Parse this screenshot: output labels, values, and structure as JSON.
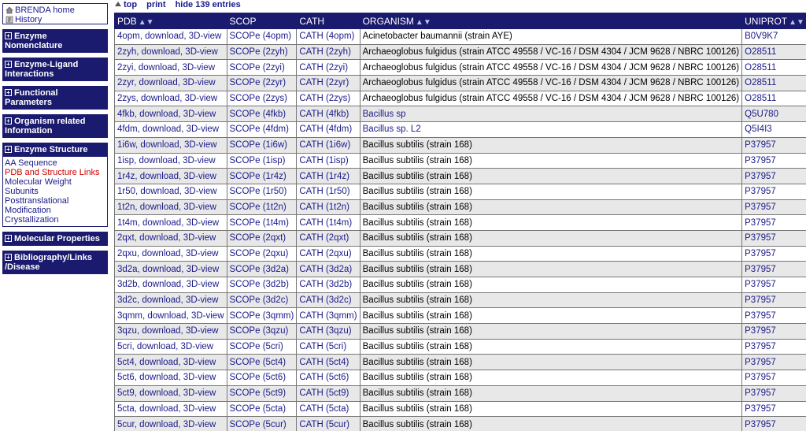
{
  "sidebar": {
    "home": "BRENDA home",
    "history": "History",
    "sections": [
      {
        "label": "Enzyme Nomenclature"
      },
      {
        "label": "Enzyme-Ligand Interactions"
      },
      {
        "label": "Functional Parameters"
      },
      {
        "label": "Organism related Information"
      },
      {
        "label": "Enzyme Structure",
        "items": [
          "AA Sequence",
          "PDB and Structure Links",
          "Molecular Weight",
          "Subunits",
          "Posttranslational Modification",
          "Crystallization"
        ],
        "active": 1
      },
      {
        "label": "Molecular Properties"
      },
      {
        "label": "Bibliography/Links /Disease"
      }
    ]
  },
  "toplinks": {
    "top": "top",
    "print": "print",
    "hide": "hide 139 entries"
  },
  "table": {
    "headers": [
      "PDB",
      "SCOP",
      "CATH",
      "ORGANISM",
      "UNIPROT"
    ],
    "sortable": [
      true,
      false,
      false,
      true,
      true
    ],
    "rows": [
      [
        "4opm, download, 3D-view",
        "SCOPe (4opm)",
        "CATH (4opm)",
        "Acinetobacter baumannii (strain AYE)",
        "B0V9K7"
      ],
      [
        "2zyh, download, 3D-view",
        "SCOPe (2zyh)",
        "CATH (2zyh)",
        "Archaeoglobus fulgidus (strain ATCC 49558 / VC-16 / DSM 4304 / JCM 9628 / NBRC 100126)",
        "O28511"
      ],
      [
        "2zyi, download, 3D-view",
        "SCOPe (2zyi)",
        "CATH (2zyi)",
        "Archaeoglobus fulgidus (strain ATCC 49558 / VC-16 / DSM 4304 / JCM 9628 / NBRC 100126)",
        "O28511"
      ],
      [
        "2zyr, download, 3D-view",
        "SCOPe (2zyr)",
        "CATH (2zyr)",
        "Archaeoglobus fulgidus (strain ATCC 49558 / VC-16 / DSM 4304 / JCM 9628 / NBRC 100126)",
        "O28511"
      ],
      [
        "2zys, download, 3D-view",
        "SCOPe (2zys)",
        "CATH (2zys)",
        "Archaeoglobus fulgidus (strain ATCC 49558 / VC-16 / DSM 4304 / JCM 9628 / NBRC 100126)",
        "O28511"
      ],
      [
        "4fkb, download, 3D-view",
        "SCOPe (4fkb)",
        "CATH (4fkb)",
        "Bacillus sp",
        "Q5U780"
      ],
      [
        "4fdm, download, 3D-view",
        "SCOPe (4fdm)",
        "CATH (4fdm)",
        "Bacillus sp. L2",
        "Q5I4I3"
      ],
      [
        "1i6w, download, 3D-view",
        "SCOPe (1i6w)",
        "CATH (1i6w)",
        "Bacillus subtilis (strain 168)",
        "P37957"
      ],
      [
        "1isp, download, 3D-view",
        "SCOPe (1isp)",
        "CATH (1isp)",
        "Bacillus subtilis (strain 168)",
        "P37957"
      ],
      [
        "1r4z, download, 3D-view",
        "SCOPe (1r4z)",
        "CATH (1r4z)",
        "Bacillus subtilis (strain 168)",
        "P37957"
      ],
      [
        "1r50, download, 3D-view",
        "SCOPe (1r50)",
        "CATH (1r50)",
        "Bacillus subtilis (strain 168)",
        "P37957"
      ],
      [
        "1t2n, download, 3D-view",
        "SCOPe (1t2n)",
        "CATH (1t2n)",
        "Bacillus subtilis (strain 168)",
        "P37957"
      ],
      [
        "1t4m, download, 3D-view",
        "SCOPe (1t4m)",
        "CATH (1t4m)",
        "Bacillus subtilis (strain 168)",
        "P37957"
      ],
      [
        "2qxt, download, 3D-view",
        "SCOPe (2qxt)",
        "CATH (2qxt)",
        "Bacillus subtilis (strain 168)",
        "P37957"
      ],
      [
        "2qxu, download, 3D-view",
        "SCOPe (2qxu)",
        "CATH (2qxu)",
        "Bacillus subtilis (strain 168)",
        "P37957"
      ],
      [
        "3d2a, download, 3D-view",
        "SCOPe (3d2a)",
        "CATH (3d2a)",
        "Bacillus subtilis (strain 168)",
        "P37957"
      ],
      [
        "3d2b, download, 3D-view",
        "SCOPe (3d2b)",
        "CATH (3d2b)",
        "Bacillus subtilis (strain 168)",
        "P37957"
      ],
      [
        "3d2c, download, 3D-view",
        "SCOPe (3d2c)",
        "CATH (3d2c)",
        "Bacillus subtilis (strain 168)",
        "P37957"
      ],
      [
        "3qmm, download, 3D-view",
        "SCOPe (3qmm)",
        "CATH (3qmm)",
        "Bacillus subtilis (strain 168)",
        "P37957"
      ],
      [
        "3qzu, download, 3D-view",
        "SCOPe (3qzu)",
        "CATH (3qzu)",
        "Bacillus subtilis (strain 168)",
        "P37957"
      ],
      [
        "5cri, download, 3D-view",
        "SCOPe (5cri)",
        "CATH (5cri)",
        "Bacillus subtilis (strain 168)",
        "P37957"
      ],
      [
        "5ct4, download, 3D-view",
        "SCOPe (5ct4)",
        "CATH (5ct4)",
        "Bacillus subtilis (strain 168)",
        "P37957"
      ],
      [
        "5ct6, download, 3D-view",
        "SCOPe (5ct6)",
        "CATH (5ct6)",
        "Bacillus subtilis (strain 168)",
        "P37957"
      ],
      [
        "5ct9, download, 3D-view",
        "SCOPe (5ct9)",
        "CATH (5ct9)",
        "Bacillus subtilis (strain 168)",
        "P37957"
      ],
      [
        "5cta, download, 3D-view",
        "SCOPe (5cta)",
        "CATH (5cta)",
        "Bacillus subtilis (strain 168)",
        "P37957"
      ],
      [
        "5cur, download, 3D-view",
        "SCOPe (5cur)",
        "CATH (5cur)",
        "Bacillus subtilis (strain 168)",
        "P37957"
      ]
    ],
    "organism_link_rows": [
      5,
      6
    ]
  },
  "icons": {
    "home": "home-icon",
    "history": "history-icon",
    "plus": "plus-icon",
    "sort": "sort-arrows-icon",
    "top": "triangle-up-icon"
  },
  "colors": {
    "header_bg": "#1a1a6e",
    "link": "#1a1a8a",
    "active": "#cc0000",
    "row_alt": "#e8e8e8"
  }
}
